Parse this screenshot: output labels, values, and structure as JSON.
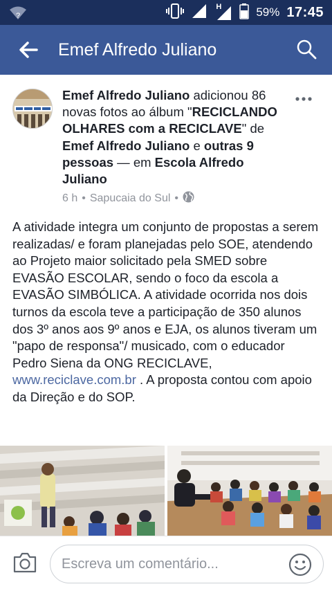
{
  "status_bar": {
    "network_type": "H",
    "battery": "59%",
    "time": "17:45",
    "icons": [
      "wifi-question-icon",
      "vibrate-icon",
      "signal-icon",
      "signal-h-icon",
      "battery-icon"
    ]
  },
  "app_bar": {
    "title": "Emef Alfredo Juliano",
    "icons": [
      "back-arrow-icon",
      "search-icon"
    ]
  },
  "post": {
    "author": "Emef Alfredo Juliano",
    "action_text": " adicionou 86 novas fotos ao álbum \"",
    "album": "RECICLANDO OLHARES com a RECICLAVE",
    "by_text": "\" de ",
    "album_owner": "Emef Alfredo Juliano",
    "and_text": " e ",
    "others": "outras 9 pessoas",
    "at_text": " — em ",
    "place": "Escola Alfredo Juliano",
    "time_ago": "6 h",
    "separator": "•",
    "location": "Sapucaia do Sul",
    "privacy_icon": "globe-icon",
    "body_text": "A atividade integra um conjunto de propostas a serem realizadas/  e foram planejadas pelo SOE,  atendendo ao Projeto maior solicitado pela SMED sobre EVASÃO ESCOLAR, sendo o foco da escola a EVASÃO SIMBÓLICA. A atividade ocorrida nos dois turnos da escola teve a participação de 350 alunos dos 3º anos aos 9º anos e EJA, os alunos tiveram um \"papo de responsa\"/ musicado, com o educador Pedro Siena da ONG RECICLAVE, ",
    "link": "www.reciclave.com.br",
    "body_end": " . A proposta contou com apoio da Direção e do  SOP."
  },
  "comment_bar": {
    "placeholder": "Escreva um comentário...",
    "icons": [
      "camera-icon",
      "emoji-icon"
    ]
  },
  "colors": {
    "status_bar": "#1b2f5c",
    "app_bar": "#3b5998",
    "link": "#4b67a1",
    "meta": "#90949c"
  }
}
